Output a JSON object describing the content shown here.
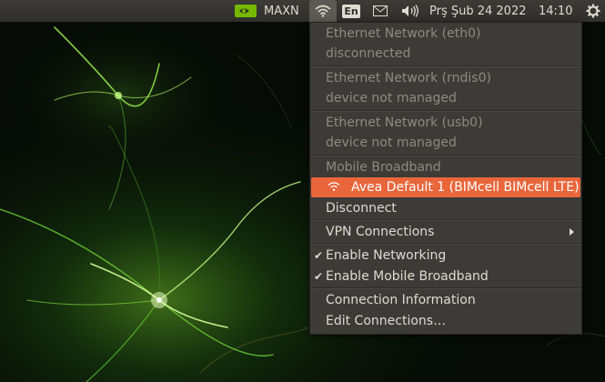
{
  "topbar": {
    "maxn": "MAXN",
    "lang": "En",
    "date": "Prş Şub 24 2022",
    "time": "14:10",
    "icons": [
      "nvidia-icon",
      "wifi-icon",
      "keyboard-language-icon",
      "mail-icon",
      "volume-icon",
      "gear-icon"
    ]
  },
  "network_menu": {
    "eth0_title": "Ethernet Network (eth0)",
    "eth0_status": "disconnected",
    "rndis0_title": "Ethernet Network (rndis0)",
    "rndis0_status": "device not managed",
    "usb0_title": "Ethernet Network (usb0)",
    "usb0_status": "device not managed",
    "mobile_title": "Mobile Broadband",
    "active_connection": "Avea Default 1 (BIMcell BIMcell LTE)",
    "disconnect": "Disconnect",
    "vpn": "VPN Connections",
    "enable_networking": "Enable Networking",
    "enable_mobile": "Enable Mobile Broadband",
    "connection_info": "Connection Information",
    "edit_connections": "Edit Connections…",
    "highlight_color": "#e9663b"
  }
}
